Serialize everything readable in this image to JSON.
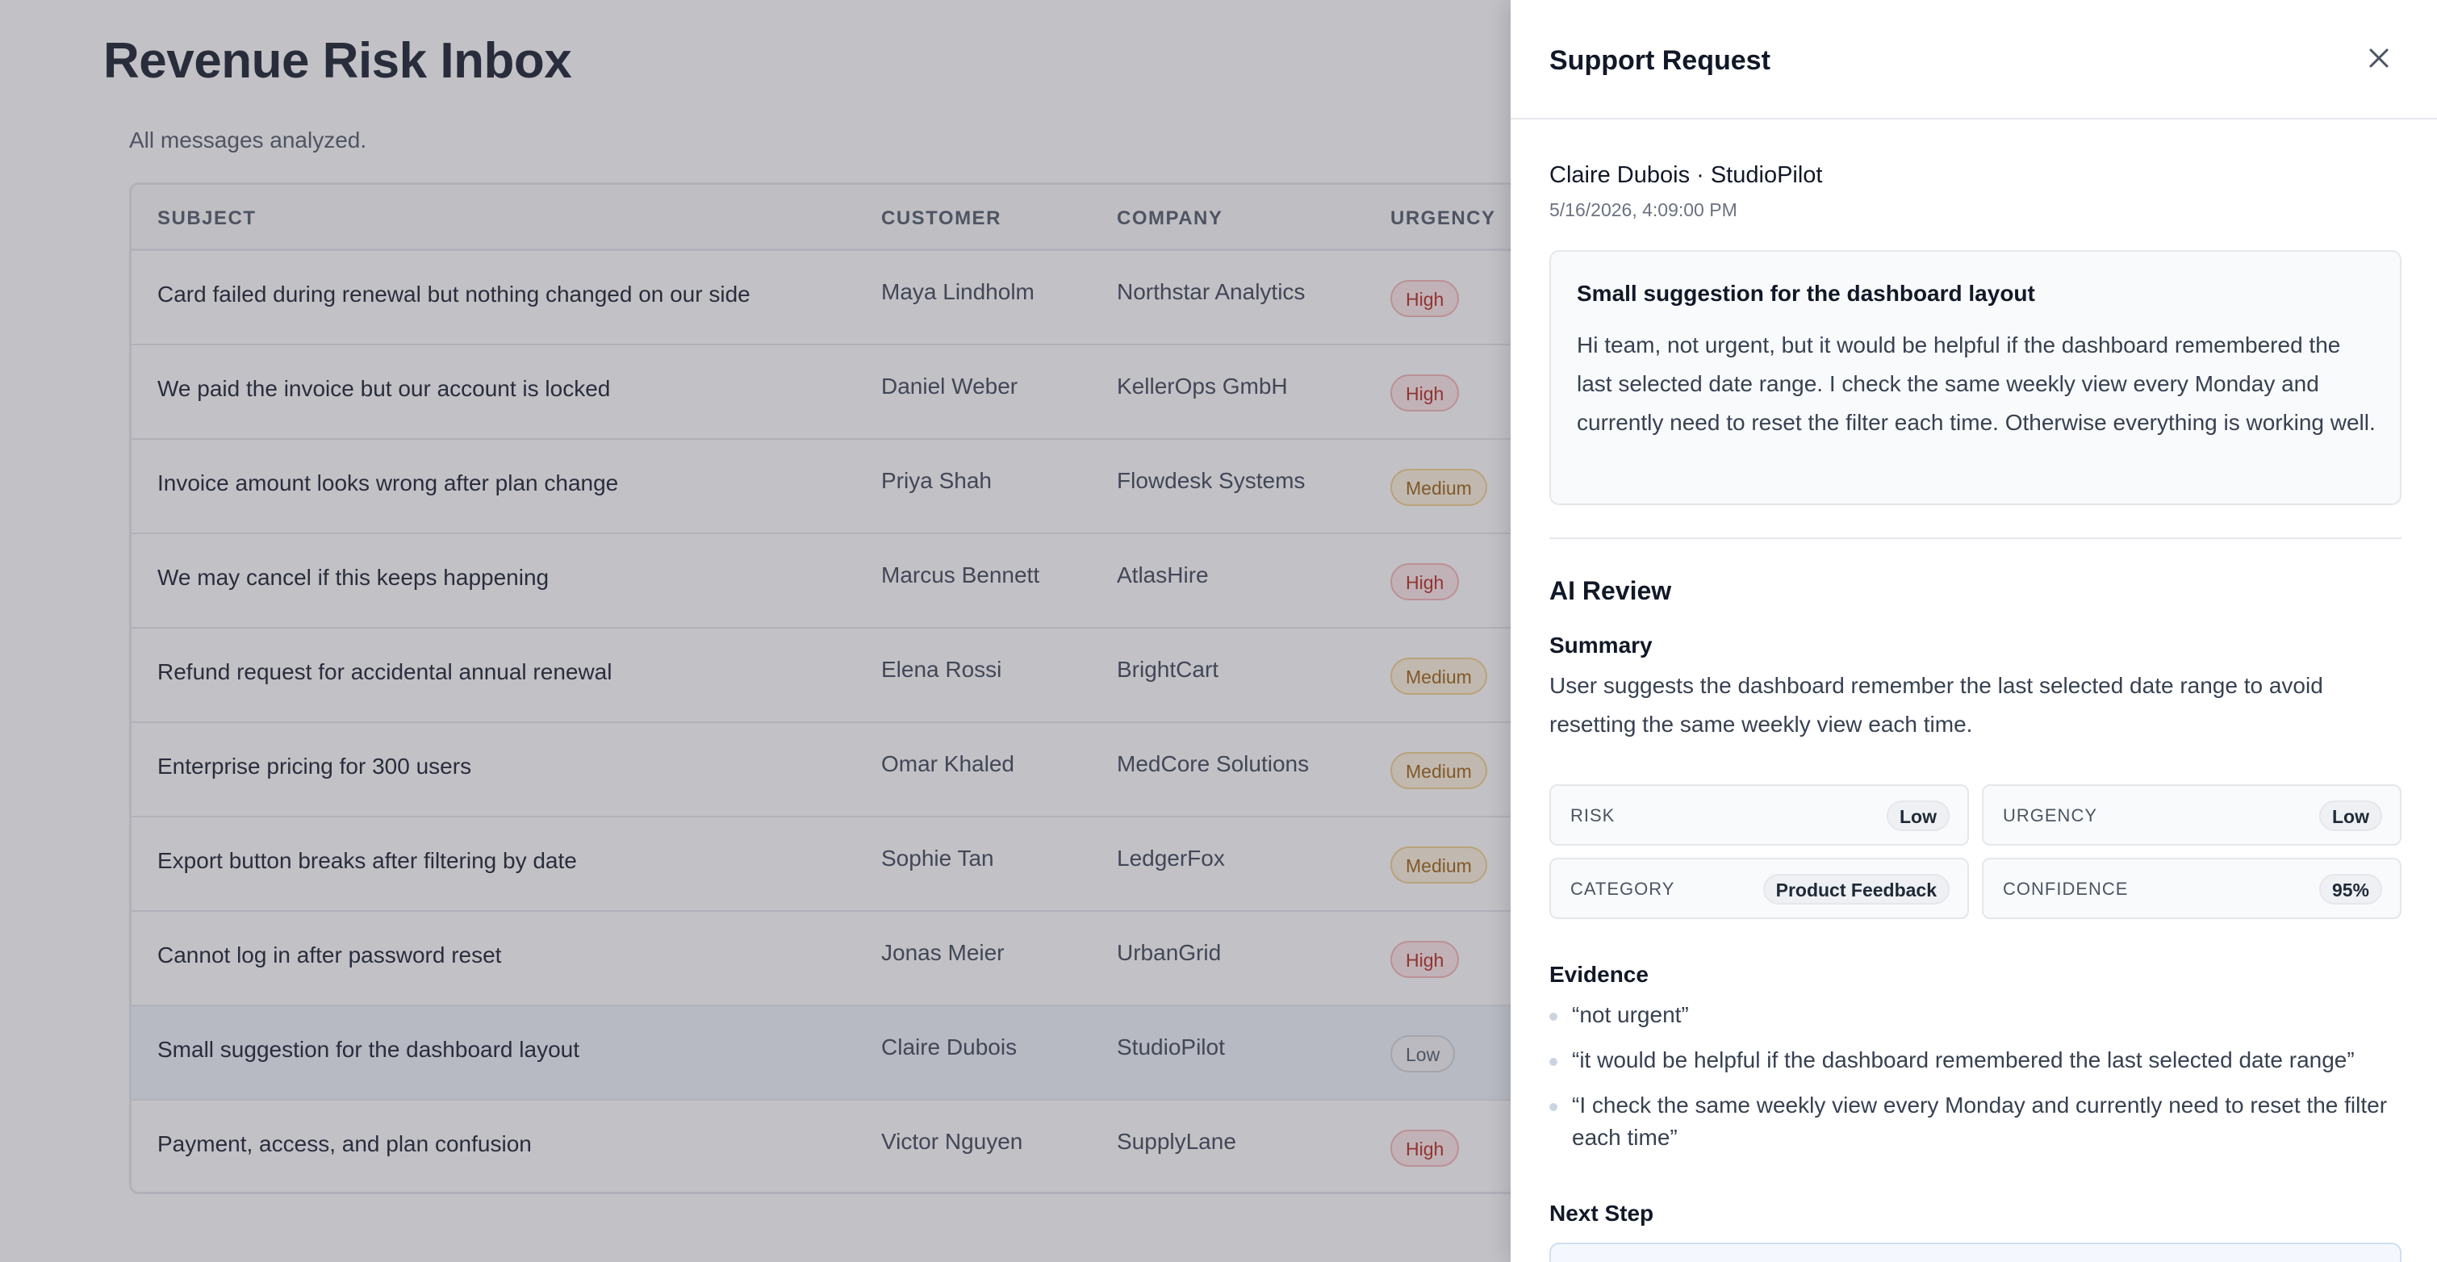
{
  "page": {
    "title": "Revenue Risk Inbox",
    "subtitle": "All messages analyzed."
  },
  "table": {
    "columns": [
      "SUBJECT",
      "CUSTOMER",
      "COMPANY",
      "URGENCY"
    ],
    "rows": [
      {
        "subject": "Card failed during renewal but nothing changed on our side",
        "customer": "Maya Lindholm",
        "company": "Northstar Analytics",
        "urgency": "High"
      },
      {
        "subject": "We paid the invoice but our account is locked",
        "customer": "Daniel Weber",
        "company": "KellerOps GmbH",
        "urgency": "High"
      },
      {
        "subject": "Invoice amount looks wrong after plan change",
        "customer": "Priya Shah",
        "company": "Flowdesk Systems",
        "urgency": "Medium"
      },
      {
        "subject": "We may cancel if this keeps happening",
        "customer": "Marcus Bennett",
        "company": "AtlasHire",
        "urgency": "High"
      },
      {
        "subject": "Refund request for accidental annual renewal",
        "customer": "Elena Rossi",
        "company": "BrightCart",
        "urgency": "Medium"
      },
      {
        "subject": "Enterprise pricing for 300 users",
        "customer": "Omar Khaled",
        "company": "MedCore Solutions",
        "urgency": "Medium"
      },
      {
        "subject": "Export button breaks after filtering by date",
        "customer": "Sophie Tan",
        "company": "LedgerFox",
        "urgency": "Medium"
      },
      {
        "subject": "Cannot log in after password reset",
        "customer": "Jonas Meier",
        "company": "UrbanGrid",
        "urgency": "High"
      },
      {
        "subject": "Small suggestion for the dashboard layout",
        "customer": "Claire Dubois",
        "company": "StudioPilot",
        "urgency": "Low",
        "selected": true
      },
      {
        "subject": "Payment, access, and plan confusion",
        "customer": "Victor Nguyen",
        "company": "SupplyLane",
        "urgency": "High"
      }
    ]
  },
  "drawer": {
    "title": "Support Request",
    "close_icon": "close-icon",
    "sender": "Claire Dubois · StudioPilot",
    "timestamp": "5/16/2026, 4:09:00 PM",
    "message_subject": "Small suggestion for the dashboard layout",
    "message_body": "Hi team, not urgent, but it would be helpful if the dashboard remembered the last selected date range. I check the same weekly view every Monday and currently need to reset the filter each time. Otherwise everything is working well.",
    "ai_review": {
      "heading": "AI Review",
      "summary_heading": "Summary",
      "summary": "User suggests the dashboard remember the last selected date range to avoid resetting the same weekly view each time.",
      "metrics": [
        {
          "label": "RISK",
          "value": "Low"
        },
        {
          "label": "URGENCY",
          "value": "Low"
        },
        {
          "label": "CATEGORY",
          "value": "Product Feedback"
        },
        {
          "label": "CONFIDENCE",
          "value": "95%"
        }
      ],
      "evidence_heading": "Evidence",
      "evidence": [
        "“not urgent”",
        "“it would be helpful if the dashboard remembered the last selected date range”",
        "“I check the same weekly view every Monday and currently need to reset the filter each time”"
      ],
      "next_step_heading": "Next Step"
    }
  },
  "colors": {
    "overlay": "#555260",
    "high_badge": "#b42318",
    "medium_badge": "#9a5b0a",
    "low_badge": "#4b5563",
    "selected_row": "#eef2fb"
  }
}
